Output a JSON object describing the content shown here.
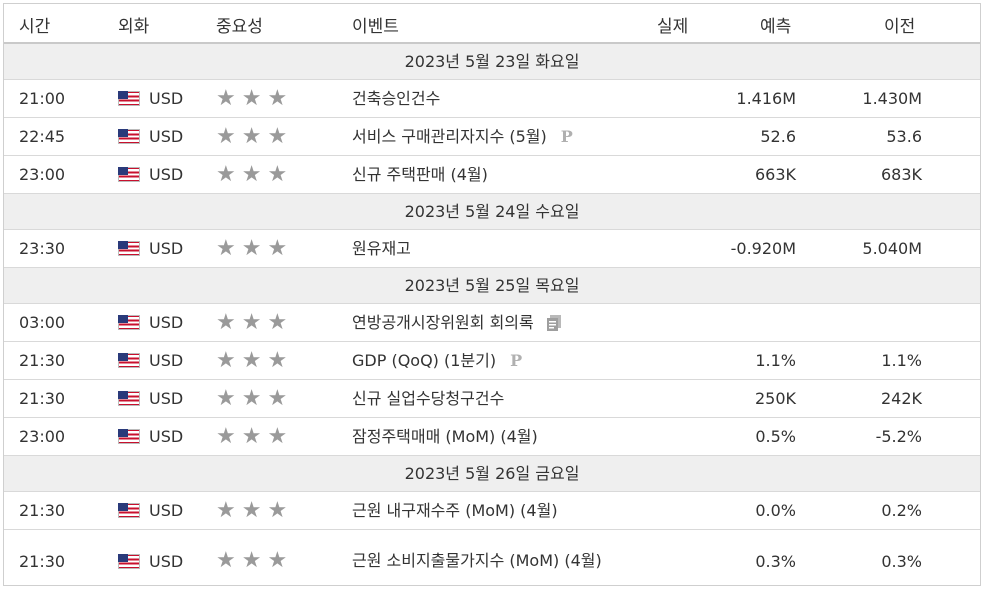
{
  "header": {
    "time": "시간",
    "currency": "외화",
    "importance": "중요성",
    "event": "이벤트",
    "actual": "실제",
    "forecast": "예측",
    "previous": "이전"
  },
  "colors": {
    "header_border": "#c9c9c9",
    "day_bg": "#efefef",
    "star": "#9a9a9a"
  },
  "days": [
    {
      "label": "2023년 5월 23일 화요일",
      "events": [
        {
          "time": "21:00",
          "currency": "USD",
          "event": "건축승인건수",
          "icon": "",
          "actual": "",
          "forecast": "1.416M",
          "previous": "1.430M"
        },
        {
          "time": "22:45",
          "currency": "USD",
          "event": "서비스 구매관리자지수 (5월)",
          "icon": "preliminary-icon",
          "actual": "",
          "forecast": "52.6",
          "previous": "53.6"
        },
        {
          "time": "23:00",
          "currency": "USD",
          "event": "신규 주택판매 (4월)",
          "icon": "",
          "actual": "",
          "forecast": "663K",
          "previous": "683K"
        }
      ]
    },
    {
      "label": "2023년 5월 24일 수요일",
      "events": [
        {
          "time": "23:30",
          "currency": "USD",
          "event": "원유재고",
          "icon": "",
          "actual": "",
          "forecast": "-0.920M",
          "previous": "5.040M"
        }
      ]
    },
    {
      "label": "2023년 5월 25일 목요일",
      "events": [
        {
          "time": "03:00",
          "currency": "USD",
          "event": "연방공개시장위원회 회의록",
          "icon": "document-icon",
          "actual": "",
          "forecast": "",
          "previous": ""
        },
        {
          "time": "21:30",
          "currency": "USD",
          "event": "GDP (QoQ) (1분기)",
          "icon": "preliminary-icon",
          "actual": "",
          "forecast": "1.1%",
          "previous": "1.1%"
        },
        {
          "time": "21:30",
          "currency": "USD",
          "event": "신규 실업수당청구건수",
          "icon": "",
          "actual": "",
          "forecast": "250K",
          "previous": "242K"
        },
        {
          "time": "23:00",
          "currency": "USD",
          "event": "잠정주택매매 (MoM) (4월)",
          "icon": "",
          "actual": "",
          "forecast": "0.5%",
          "previous": "-5.2%"
        }
      ]
    },
    {
      "label": "2023년 5월 26일 금요일",
      "events": [
        {
          "time": "21:30",
          "currency": "USD",
          "event": "근원 내구재수주 (MoM) (4월)",
          "icon": "",
          "actual": "",
          "forecast": "0.0%",
          "previous": "0.2%"
        },
        {
          "time": "21:30",
          "currency": "USD",
          "event": "근원 소비지출물가지수 (MoM) (4월)",
          "icon": "",
          "actual": "",
          "forecast": "0.3%",
          "previous": "0.3%"
        }
      ]
    }
  ],
  "importance_stars": 3,
  "preliminary_mark": "P",
  "star_glyph": "★"
}
